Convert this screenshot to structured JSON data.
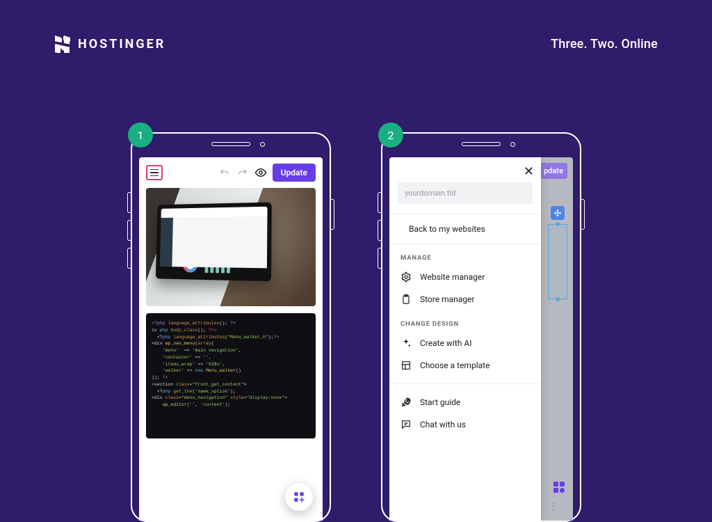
{
  "brand": {
    "name": "HOSTINGER",
    "tagline": "Three. Two. Online"
  },
  "steps": {
    "one": "1",
    "two": "2"
  },
  "phone1": {
    "toolbar": {
      "update": "Update"
    }
  },
  "phone2": {
    "bg_update": "pdate",
    "drawer": {
      "domain_placeholder": "yourdomain.tld",
      "back": "Back to my websites",
      "section_manage": "MANAGE",
      "section_design": "CHANGE DESIGN",
      "items": {
        "website_manager": "Website manager",
        "store_manager": "Store manager",
        "create_ai": "Create with AI",
        "choose_template": "Choose a template",
        "start_guide": "Start guide",
        "chat_with_us": "Chat with us"
      }
    }
  }
}
